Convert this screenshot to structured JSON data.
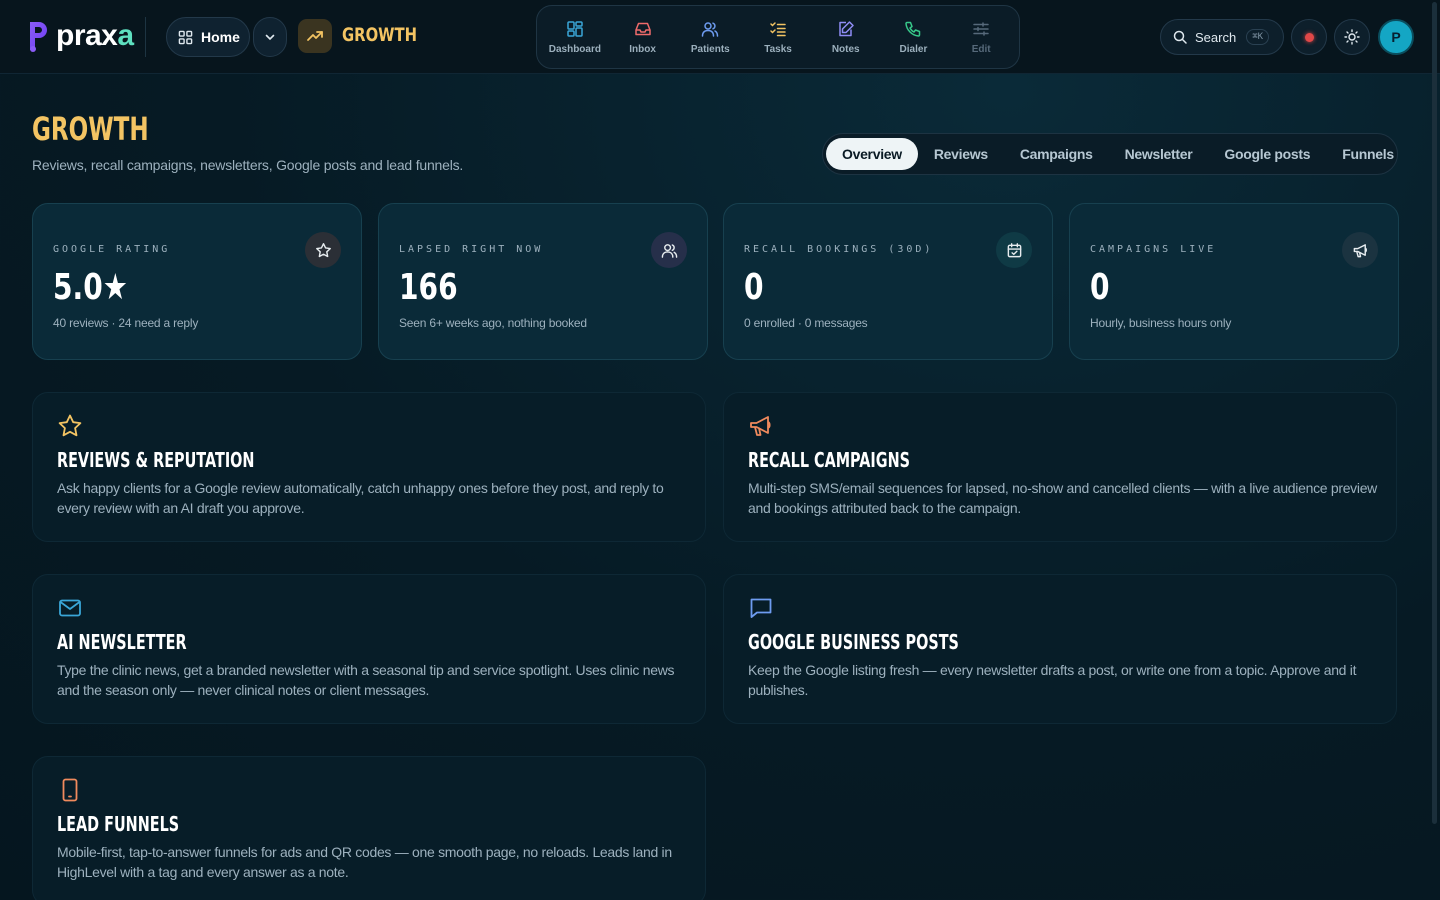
{
  "app": {
    "logo_text_main": "prax",
    "logo_text_accent": "a",
    "home_label": "Home",
    "section_label": "GROWTH"
  },
  "nav": [
    {
      "label": "Dashboard",
      "icon": "dashboard-icon",
      "color": "#3aa6d8"
    },
    {
      "label": "Inbox",
      "icon": "inbox-icon",
      "color": "#ef6b6b"
    },
    {
      "label": "Patients",
      "icon": "patients-icon",
      "color": "#6e9cf0"
    },
    {
      "label": "Tasks",
      "icon": "tasks-icon",
      "color": "#f3c463"
    },
    {
      "label": "Notes",
      "icon": "notes-icon",
      "color": "#8f8cf5"
    },
    {
      "label": "Dialer",
      "icon": "phone-icon",
      "color": "#37c98a"
    },
    {
      "label": "Edit",
      "icon": "sliders-icon",
      "color": "#56697a"
    }
  ],
  "search": {
    "label": "Search",
    "shortcut": "⌘K"
  },
  "user": {
    "initial": "P"
  },
  "page": {
    "title": "GROWTH",
    "subtitle": "Reviews, recall campaigns, newsletters, Google posts and lead funnels."
  },
  "tabs": [
    "Overview",
    "Reviews",
    "Campaigns",
    "Newsletter",
    "Google posts",
    "Funnels"
  ],
  "active_tab": "Overview",
  "stats": [
    {
      "label": "GOOGLE RATING",
      "value": "5.0★",
      "sub": "40 reviews · 24 need a reply",
      "icon": "star-icon"
    },
    {
      "label": "LAPSED RIGHT NOW",
      "value": "166",
      "sub": "Seen 6+ weeks ago, nothing booked",
      "icon": "users-icon"
    },
    {
      "label": "RECALL BOOKINGS (30D)",
      "value": "0",
      "sub": "0 enrolled · 0 messages",
      "icon": "calendar-check-icon"
    },
    {
      "label": "CAMPAIGNS LIVE",
      "value": "0",
      "sub": "Hourly, business hours only",
      "icon": "megaphone-icon"
    }
  ],
  "features": [
    {
      "title": "REVIEWS & REPUTATION",
      "desc": "Ask happy clients for a Google review automatically, catch unhappy ones before they post, and reply to every review with an AI draft you approve.",
      "icon": "star-icon",
      "color": "#f3c463"
    },
    {
      "title": "RECALL CAMPAIGNS",
      "desc": "Multi-step SMS/email sequences for lapsed, no-show and cancelled clients — with a live audience preview and bookings attributed back to the campaign.",
      "icon": "megaphone-icon",
      "color": "#f08a5d"
    },
    {
      "title": "AI NEWSLETTER",
      "desc": "Type the clinic news, get a branded newsletter with a seasonal tip and service spotlight. Uses clinic news and the season only — never clinical notes or client messages.",
      "icon": "mail-icon",
      "color": "#3aa6d8"
    },
    {
      "title": "GOOGLE BUSINESS POSTS",
      "desc": "Keep the Google listing fresh — every newsletter drafts a post, or write one from a topic. Approve and it publishes.",
      "icon": "message-square-icon",
      "color": "#6e9cf0"
    },
    {
      "title": "LEAD FUNNELS",
      "desc": "Mobile-first, tap-to-answer funnels for ads and QR codes — one smooth page, no reloads. Leads land in HighLevel with a tag and every answer as a note.",
      "icon": "phone-device-icon",
      "color": "#f08a5d"
    }
  ]
}
